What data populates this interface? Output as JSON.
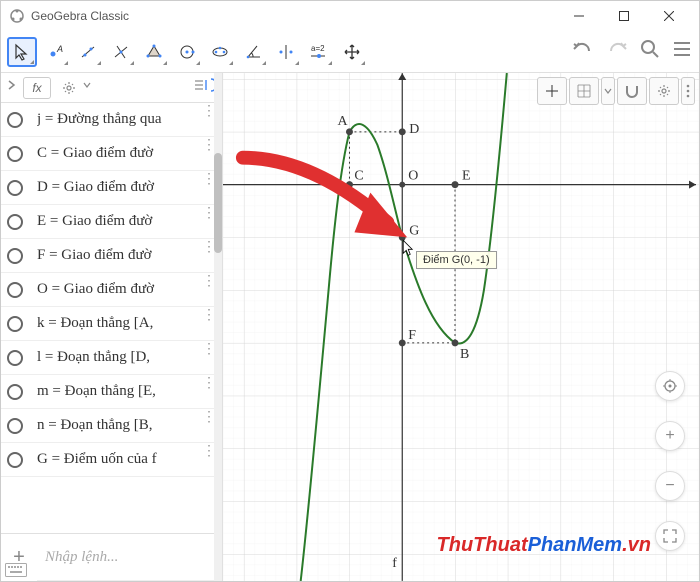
{
  "app": {
    "title": "GeoGebra Classic"
  },
  "sidebar": {
    "input_placeholder": "Nhập lệnh...",
    "items": [
      {
        "label": "j = Đường thẳng qua"
      },
      {
        "label": "C = Giao điểm đườ"
      },
      {
        "label": "D = Giao điểm đườ"
      },
      {
        "label": "E = Giao điểm đườ"
      },
      {
        "label": "F = Giao điểm đườ"
      },
      {
        "label": "O = Giao điểm đườ"
      },
      {
        "label": "k = Đoạn thẳng [A,"
      },
      {
        "label": "l = Đoạn thẳng [D, "
      },
      {
        "label": "m = Đoạn thẳng [E,"
      },
      {
        "label": "n = Đoạn thẳng [B,"
      },
      {
        "label": "G = Điểm uốn của f"
      }
    ]
  },
  "graph": {
    "tooltip": "Điểm G(0, -1)",
    "points": {
      "A": {
        "x": -1,
        "y": 1,
        "label": "A"
      },
      "B": {
        "x": 1,
        "y": -3,
        "label": "B"
      },
      "C": {
        "x": -1,
        "y": 0,
        "label": "C"
      },
      "D": {
        "x": 0,
        "y": 1,
        "label": "D"
      },
      "E": {
        "x": 1,
        "y": 0,
        "label": "E"
      },
      "F": {
        "x": 0,
        "y": -3,
        "label": "F"
      },
      "G": {
        "x": 0,
        "y": -1,
        "label": "G"
      },
      "O": {
        "x": 0,
        "y": 0,
        "label": "O"
      }
    },
    "curve_label": "f"
  },
  "watermark": {
    "part1": "ThuThuat",
    "part2": "PhanMem",
    "part3": ".vn"
  },
  "chart_data": {
    "type": "line",
    "title": "",
    "xlabel": "",
    "ylabel": "",
    "xlim": [
      -4,
      6
    ],
    "ylim": [
      -9,
      3
    ],
    "series": [
      {
        "name": "f",
        "type": "cubic",
        "description": "y = x^3 - 3x - 1 (inflection at G(0,-1), local max at A(-1,1), local min at B(1,-3))"
      }
    ],
    "points": [
      {
        "name": "A",
        "x": -1,
        "y": 1
      },
      {
        "name": "B",
        "x": 1,
        "y": -3
      },
      {
        "name": "C",
        "x": -1,
        "y": 0
      },
      {
        "name": "D",
        "x": 0,
        "y": 1
      },
      {
        "name": "E",
        "x": 1,
        "y": 0
      },
      {
        "name": "F",
        "x": 0,
        "y": -3
      },
      {
        "name": "G",
        "x": 0,
        "y": -1
      },
      {
        "name": "O",
        "x": 0,
        "y": 0
      }
    ]
  }
}
